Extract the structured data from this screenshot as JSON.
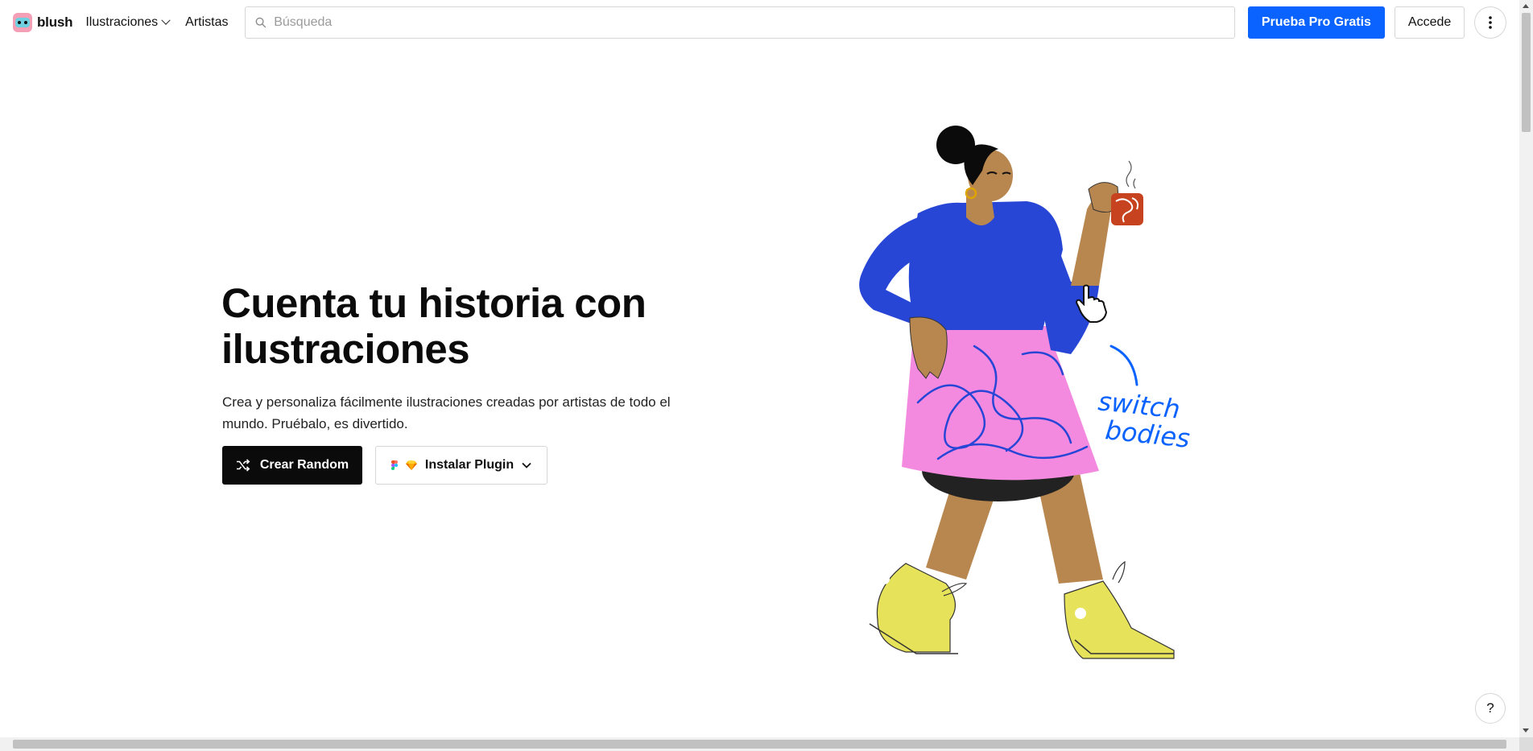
{
  "header": {
    "logo_text": "blush",
    "nav": {
      "illustrations_label": "Ilustraciones",
      "artists_label": "Artistas"
    },
    "search": {
      "placeholder": "Búsqueda",
      "value": ""
    },
    "pro_button_label": "Prueba Pro Gratis",
    "login_button_label": "Accede",
    "more_icon": "more-vertical-icon"
  },
  "hero": {
    "title": "Cuenta tu historia con ilustraciones",
    "subtitle": "Crea y personaliza fácilmente ilustraciones creadas por artistas de todo el mundo. Pruébalo, es divertido.",
    "random_button_label": "Crear Random",
    "random_icon": "shuffle-icon",
    "plugin_button_label": "Instalar Plugin",
    "plugin_icons": [
      "figma-icon",
      "sketch-icon"
    ]
  },
  "illustration": {
    "handwritten_line1": "switch",
    "handwritten_line2": "bodies"
  },
  "help_button_label": "?",
  "colors": {
    "accent": "#0a63ff",
    "primary_button": "#0b0b0b",
    "shirt": "#2746d6",
    "skirt": "#f48ae0",
    "shoes": "#e6e35a",
    "skin": "#b8864f"
  }
}
